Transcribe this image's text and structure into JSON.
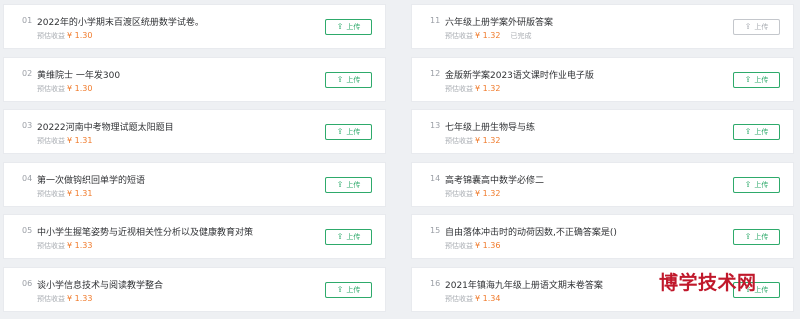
{
  "income_label": "预估收益",
  "upload_label": "上传",
  "left_items": [
    {
      "num": "01",
      "title": "2022年的小学期末百渡区统册数学试卷。",
      "amount": "¥ 1.30"
    },
    {
      "num": "02",
      "title": "黄维院士 一年发300",
      "amount": "¥ 1.30"
    },
    {
      "num": "03",
      "title": "20222河南中考物理试题太阳题目",
      "amount": "¥ 1.31"
    },
    {
      "num": "04",
      "title": "第一次做钩织回单学的短语",
      "amount": "¥ 1.31"
    },
    {
      "num": "05",
      "title": "中小学生握笔姿势与近视相关性分析以及健康教育对策",
      "amount": "¥ 1.33"
    },
    {
      "num": "06",
      "title": "谈小学信息技术与阅读教学整合",
      "amount": "¥ 1.33"
    }
  ],
  "right_items": [
    {
      "num": "11",
      "title": "六年级上册学案外研版答案",
      "amount": "¥ 1.32",
      "status": "已完成",
      "disabled": true
    },
    {
      "num": "12",
      "title": "金版新学案2023语文课时作业电子版",
      "amount": "¥ 1.32"
    },
    {
      "num": "13",
      "title": "七年级上册生物导与练",
      "amount": "¥ 1.32"
    },
    {
      "num": "14",
      "title": "高考锦囊高中数学必修二",
      "amount": "¥ 1.32"
    },
    {
      "num": "15",
      "title": "自由落体冲击时的动荷因数,不正确答案是()",
      "amount": "¥ 1.36"
    },
    {
      "num": "16",
      "title": "2021年镇海九年级上册语文期末卷答案",
      "amount": "¥ 1.34"
    }
  ],
  "watermark": "博学技术网",
  "colors": {
    "accent": "#2eaa6b",
    "amount": "#f07b2c",
    "watermark": "#c0182b"
  }
}
